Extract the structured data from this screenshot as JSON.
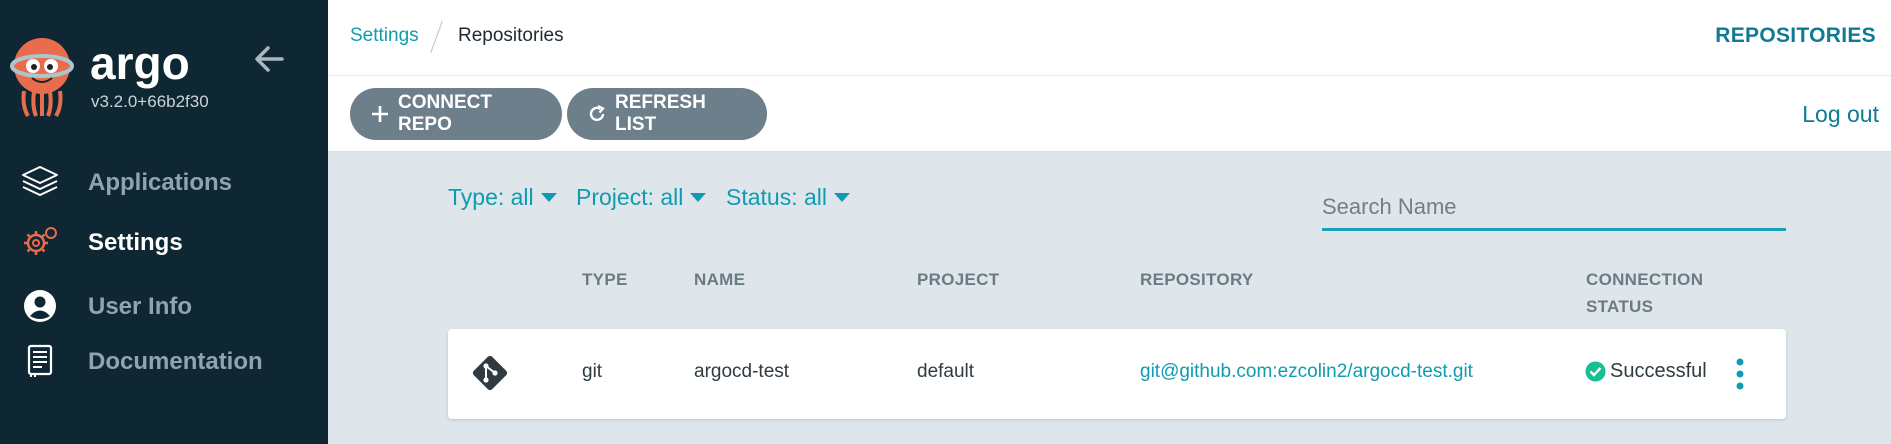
{
  "sidebar": {
    "brand": "argo",
    "version": "v3.2.0+66b2f30",
    "items": [
      {
        "label": "Applications",
        "icon": "layers-icon",
        "active": false
      },
      {
        "label": "Settings",
        "icon": "gear-icon",
        "active": true
      },
      {
        "label": "User Info",
        "icon": "user-icon",
        "active": false
      },
      {
        "label": "Documentation",
        "icon": "book-icon",
        "active": false
      }
    ]
  },
  "header": {
    "breadcrumb": [
      "Settings",
      "Repositories"
    ],
    "title": "REPOSITORIES"
  },
  "toolbar": {
    "connect_label": "CONNECT REPO",
    "refresh_label": "REFRESH LIST",
    "logout_label": "Log out"
  },
  "filters": {
    "type": "Type: all",
    "project": "Project: all",
    "status": "Status: all",
    "search_placeholder": "Search Name"
  },
  "table": {
    "columns": [
      "TYPE",
      "NAME",
      "PROJECT",
      "REPOSITORY",
      "CONNECTION",
      "STATUS"
    ],
    "rows": [
      {
        "type": "git",
        "name": "argocd-test",
        "project": "default",
        "repository": "git@github.com:ezcolin2/argocd-test.git",
        "status": "Successful"
      }
    ]
  },
  "colors": {
    "sidebar_bg": "#0f2733",
    "accent": "#0f9cb0",
    "button_bg": "#6d7f8b",
    "success": "#18be94",
    "settings_icon": "#e96d4c"
  }
}
